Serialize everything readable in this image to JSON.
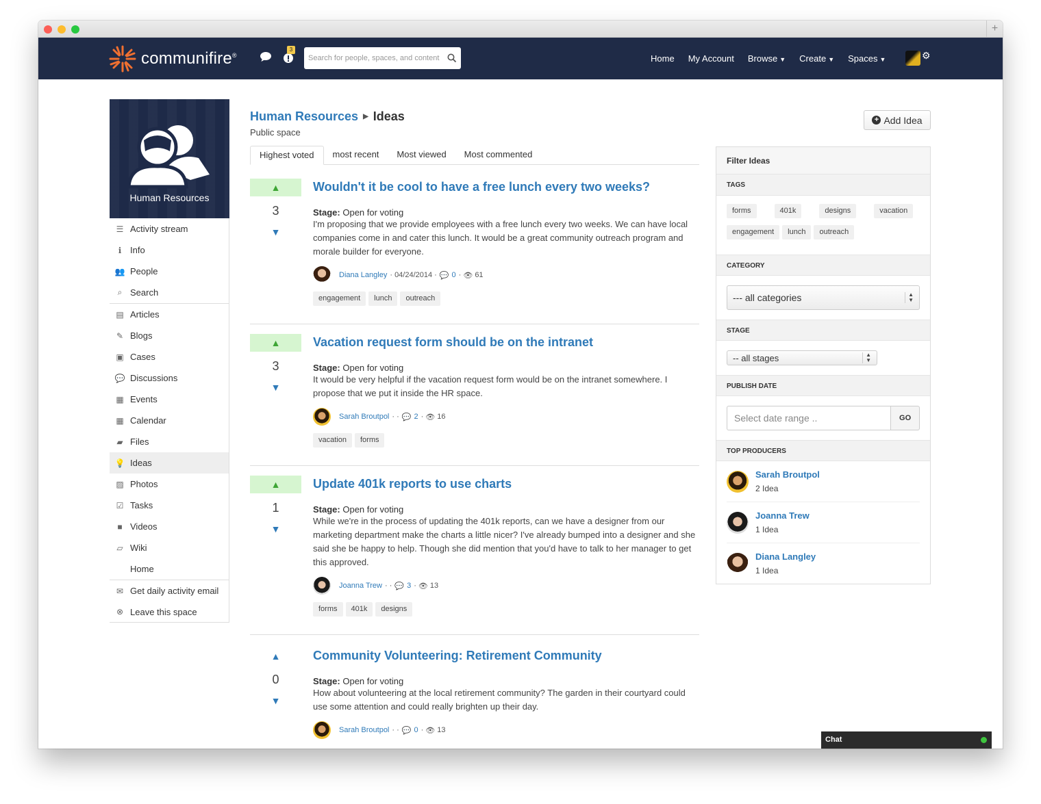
{
  "window": {
    "new_tab": "+"
  },
  "nav": {
    "logo_text": "communifire",
    "logo_mark": "®",
    "notif_count": "3",
    "search_placeholder": "Search for people, spaces, and content",
    "links": [
      "Home",
      "My Account",
      "Browse",
      "Create",
      "Spaces"
    ]
  },
  "space": {
    "name": "Human Resources",
    "menu": [
      {
        "label": "Activity stream",
        "icon": "list-icon",
        "glyph": "☰"
      },
      {
        "label": "Info",
        "icon": "info-icon",
        "glyph": "ℹ"
      },
      {
        "label": "People",
        "icon": "people-icon",
        "glyph": "👥"
      },
      {
        "label": "Search",
        "icon": "search-icon",
        "glyph": "⌕"
      },
      {
        "label": "Articles",
        "icon": "article-icon",
        "glyph": "▤"
      },
      {
        "label": "Blogs",
        "icon": "blog-icon",
        "glyph": "✎"
      },
      {
        "label": "Cases",
        "icon": "briefcase-icon",
        "glyph": "▣"
      },
      {
        "label": "Discussions",
        "icon": "discussion-icon",
        "glyph": "💬"
      },
      {
        "label": "Events",
        "icon": "events-icon",
        "glyph": "▦"
      },
      {
        "label": "Calendar",
        "icon": "calendar-icon",
        "glyph": "▦"
      },
      {
        "label": "Files",
        "icon": "folder-icon",
        "glyph": "▰"
      },
      {
        "label": "Ideas",
        "icon": "lightbulb-icon",
        "glyph": "💡"
      },
      {
        "label": "Photos",
        "icon": "photo-icon",
        "glyph": "▨"
      },
      {
        "label": "Tasks",
        "icon": "check-icon",
        "glyph": "☑"
      },
      {
        "label": "Videos",
        "icon": "video-icon",
        "glyph": "■"
      },
      {
        "label": "Wiki",
        "icon": "book-icon",
        "glyph": "▱"
      },
      {
        "label": "Home",
        "icon": "",
        "glyph": ""
      },
      {
        "label": "Get daily activity email",
        "icon": "envelope-icon",
        "glyph": "✉"
      },
      {
        "label": "Leave this space",
        "icon": "close-circle-icon",
        "glyph": "⊗"
      }
    ]
  },
  "header": {
    "space_link": "Human Resources",
    "page_title": "Ideas",
    "subtitle": "Public space",
    "add_idea": "Add Idea"
  },
  "tabs": [
    "Highest voted",
    "most recent",
    "Most viewed",
    "Most commented"
  ],
  "ideas": [
    {
      "votes": "3",
      "title": "Wouldn't it be cool to have a free lunch every two weeks?",
      "stage_label": "Stage:",
      "stage": "Open for voting",
      "body": "I'm proposing that we provide employees with a free lunch every two weeks. We can have local companies come in and cater this lunch. It would be a great community outreach program and morale builder for everyone.",
      "author": "Diana Langley",
      "date": "· 04/24/2014 ·",
      "comments": "0",
      "views": "61",
      "tags": [
        "engagement",
        "lunch",
        "outreach"
      ]
    },
    {
      "votes": "3",
      "title": "Vacation request form should be on the intranet",
      "stage_label": "Stage:",
      "stage": "Open for voting",
      "body": "It would be very helpful if the vacation request form would be on the intranet somewhere. I propose that we put it inside the HR space.",
      "author": "Sarah Broutpol",
      "date": "· ·",
      "comments": "2",
      "views": "16",
      "tags": [
        "vacation",
        "forms"
      ]
    },
    {
      "votes": "1",
      "title": "Update 401k reports to use charts",
      "stage_label": "Stage:",
      "stage": "Open for voting",
      "body": "While we're in the process of updating the 401k reports, can we have a designer from our marketing department make the charts a little nicer? I've already bumped into a designer and she said she be happy to help. Though she did mention that you'd have to talk to her manager to get this approved.",
      "author": "Joanna Trew",
      "date": "· ·",
      "comments": "3",
      "views": "13",
      "tags": [
        "forms",
        "401k",
        "designs"
      ]
    },
    {
      "votes": "0",
      "title": "Community Volunteering: Retirement Community",
      "stage_label": "Stage:",
      "stage": "Open for voting",
      "body": "How about volunteering at the local retirement community? The garden in their courtyard could use some attention and could really brighten up their day.",
      "author": "Sarah Broutpol",
      "date": "· ·",
      "comments": "0",
      "views": "13",
      "tags": []
    }
  ],
  "filter": {
    "title": "Filter Ideas",
    "tags_label": "TAGS",
    "tags": [
      "forms",
      "401k",
      "designs",
      "vacation",
      "engagement",
      "lunch",
      "outreach"
    ],
    "category_label": "CATEGORY",
    "category_value": "--- all categories",
    "stage_label": "STAGE",
    "stage_value": "-- all stages",
    "publish_label": "PUBLISH DATE",
    "date_placeholder": "Select date range ..",
    "go": "GO",
    "producers_label": "TOP PRODUCERS",
    "producers": [
      {
        "name": "Sarah Broutpol",
        "count": "2 Idea"
      },
      {
        "name": "Joanna Trew",
        "count": "1 Idea"
      },
      {
        "name": "Diana Langley",
        "count": "1 Idea"
      }
    ]
  },
  "chat": {
    "label": "Chat"
  },
  "colors": {
    "nav_bg": "#1f2b47",
    "link": "#2f7ab8",
    "vote_bg": "#d6f5d0",
    "vote_arrow": "#3ea535"
  }
}
